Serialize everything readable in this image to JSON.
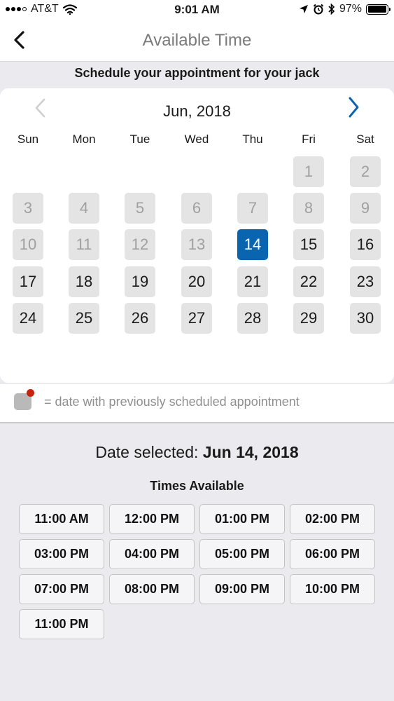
{
  "status_bar": {
    "carrier": "AT&T",
    "time": "9:01 AM",
    "battery": "97%",
    "battery_level": 0.97,
    "icons": [
      "signal-icon",
      "wifi-icon",
      "location-icon",
      "alarm-icon",
      "bluetooth-icon",
      "battery-icon"
    ]
  },
  "nav": {
    "title": "Available Time",
    "back_icon": "chevron-left-icon"
  },
  "subtitle": "Schedule your appointment for your jack",
  "calendar": {
    "month": "Jun, 2018",
    "prev_icon": "chevron-left-icon",
    "next_icon": "chevron-right-icon",
    "weekdays": [
      "Sun",
      "Mon",
      "Tue",
      "Wed",
      "Thu",
      "Fri",
      "Sat"
    ],
    "selected_day": "14",
    "days": [
      {
        "label": "1",
        "state": "disabled"
      },
      {
        "label": "2",
        "state": "disabled"
      },
      {
        "label": "3",
        "state": "disabled"
      },
      {
        "label": "4",
        "state": "disabled"
      },
      {
        "label": "5",
        "state": "disabled"
      },
      {
        "label": "6",
        "state": "disabled"
      },
      {
        "label": "7",
        "state": "disabled"
      },
      {
        "label": "8",
        "state": "disabled"
      },
      {
        "label": "9",
        "state": "disabled"
      },
      {
        "label": "10",
        "state": "disabled"
      },
      {
        "label": "11",
        "state": "disabled"
      },
      {
        "label": "12",
        "state": "disabled"
      },
      {
        "label": "13",
        "state": "disabled"
      },
      {
        "label": "14",
        "state": "selected"
      },
      {
        "label": "15",
        "state": "available"
      },
      {
        "label": "16",
        "state": "available"
      },
      {
        "label": "17",
        "state": "available"
      },
      {
        "label": "18",
        "state": "available"
      },
      {
        "label": "19",
        "state": "available"
      },
      {
        "label": "20",
        "state": "available"
      },
      {
        "label": "21",
        "state": "available"
      },
      {
        "label": "22",
        "state": "available"
      },
      {
        "label": "23",
        "state": "available"
      },
      {
        "label": "24",
        "state": "available"
      },
      {
        "label": "25",
        "state": "available"
      },
      {
        "label": "26",
        "state": "available"
      },
      {
        "label": "27",
        "state": "available"
      },
      {
        "label": "28",
        "state": "available"
      },
      {
        "label": "29",
        "state": "available"
      },
      {
        "label": "30",
        "state": "available"
      }
    ]
  },
  "legend": {
    "text": "= date with previously scheduled appointment"
  },
  "selection": {
    "prefix": "Date selected:",
    "date": "Jun 14, 2018"
  },
  "times": {
    "heading": "Times Available",
    "slots": [
      "11:00 AM",
      "12:00 PM",
      "01:00 PM",
      "02:00 PM",
      "03:00 PM",
      "04:00 PM",
      "05:00 PM",
      "06:00 PM",
      "07:00 PM",
      "08:00 PM",
      "09:00 PM",
      "10:00 PM",
      "11:00 PM"
    ]
  },
  "colors": {
    "accent": "#0a65b0",
    "legend_dot": "#c7230e",
    "day_bg": "#e4e4e4",
    "disabled_text": "#a0a0a0"
  }
}
